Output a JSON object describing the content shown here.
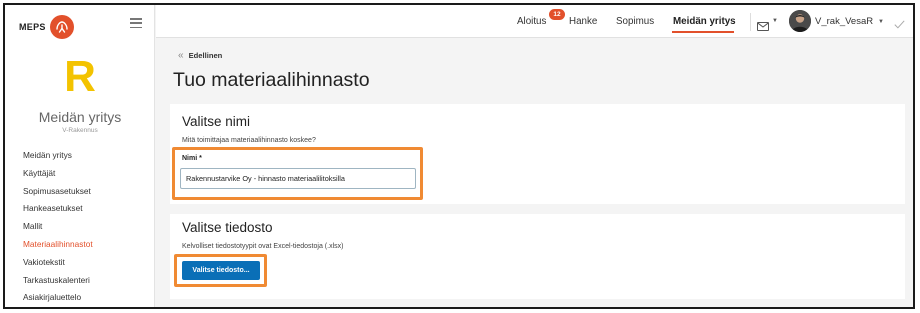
{
  "brand": {
    "text": "MEPS",
    "accent": "#e2502b"
  },
  "company": {
    "letter": "R",
    "name": "Meidän yritys",
    "subtitle": "V-Rakennus"
  },
  "sidebar": {
    "items": [
      {
        "label": "Meidän yritys"
      },
      {
        "label": "Käyttäjät"
      },
      {
        "label": "Sopimusasetukset"
      },
      {
        "label": "Hankeasetukset"
      },
      {
        "label": "Mallit"
      },
      {
        "label": "Materiaalihinnastot",
        "active": true
      },
      {
        "label": "Vakiotekstit"
      },
      {
        "label": "Tarkastuskalenteri"
      },
      {
        "label": "Asiakirjaluettelo"
      }
    ]
  },
  "topnav": {
    "items": [
      {
        "label": "Aloitus",
        "badge": "12"
      },
      {
        "label": "Hanke"
      },
      {
        "label": "Sopimus"
      },
      {
        "label": "Meidän yritys",
        "active": true
      }
    ],
    "user": "V_rak_VesaR"
  },
  "main": {
    "back_label": "Edellinen",
    "page_title": "Tuo materiaalihinnasto",
    "name_section": {
      "title": "Valitse nimi",
      "help": "Mitä toimittajaa materiaalihinnasto koskee?",
      "field_label": "Nimi *",
      "field_value": "Rakennustarvike Oy - hinnasto materiaalilitoksilla"
    },
    "file_section": {
      "title": "Valitse tiedosto",
      "help": "Kelvolliset tiedostotyypit ovat Excel-tiedostoja (.xlsx)",
      "button_label": "Valitse tiedosto..."
    }
  },
  "colors": {
    "accent": "#e2502b",
    "highlight": "#f08a33",
    "primary": "#0a6fb7",
    "logo_letter": "#f3c300"
  },
  "icons": [
    "menu-icon",
    "mail-icon",
    "chevron-down-icon",
    "avatar",
    "check-icon",
    "back-chevron-icon"
  ]
}
